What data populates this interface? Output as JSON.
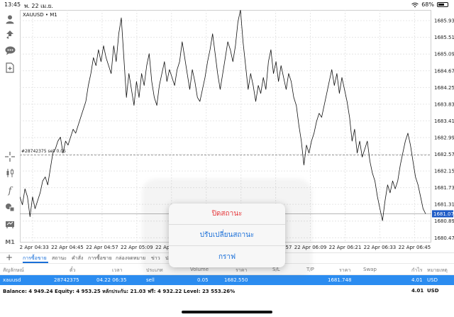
{
  "status_bar": {
    "time": "13:45",
    "date": "พ. 22 เม.ย.",
    "battery": "68%",
    "battery_level": 0.68
  },
  "sidebar": {
    "icons": [
      "user-icon",
      "trade-icon",
      "chat-icon",
      "add-document-icon",
      "crosshair-icon",
      "candles-icon",
      "function-icon",
      "objects-icon",
      "templates-icon",
      "timeframe-icon"
    ],
    "timeframe_label": "M1"
  },
  "chart": {
    "symbol_label": "XAUUSD • M1",
    "order_label": "#28742375 sell 0.05",
    "current_price_label": "1681.073",
    "colors": {
      "line": "#111111",
      "grid": "#e6e6e6",
      "order_line": "#9a9a9a",
      "price_tag": "#1e5bc6"
    }
  },
  "chart_data": {
    "type": "line",
    "x_ticks": [
      "22 Apr 04:33",
      "22 Apr 04:45",
      "22 Apr 04:57",
      "22 Apr 05:09",
      "22 Apr 05:21",
      "22 Apr 05:33",
      "22 Apr 05:45",
      "22 Apr 05:57",
      "22 Apr 06:09",
      "22 Apr 06:21",
      "22 Apr 06:33",
      "22 Apr 06:45"
    ],
    "y_ticks": [
      "1685.930",
      "1685.510",
      "1685.090",
      "1684.670",
      "1684.250",
      "1683.830",
      "1683.410",
      "1682.990",
      "1682.570",
      "1682.150",
      "1681.730",
      "1681.310",
      "1680.890",
      "1680.470"
    ],
    "ylim": [
      1680.35,
      1686.2
    ],
    "order_price": 1682.55,
    "current_price": 1681.073,
    "values": [
      1681.5,
      1681.3,
      1681.7,
      1681.5,
      1681.0,
      1681.5,
      1681.2,
      1681.4,
      1681.6,
      1681.9,
      1682.0,
      1681.8,
      1682.2,
      1682.6,
      1682.7,
      1682.9,
      1683.0,
      1682.6,
      1682.9,
      1682.8,
      1683.0,
      1683.2,
      1683.1,
      1683.3,
      1683.5,
      1683.7,
      1683.9,
      1684.3,
      1684.6,
      1685.0,
      1684.8,
      1685.2,
      1684.9,
      1685.3,
      1685.0,
      1684.8,
      1684.6,
      1685.3,
      1684.9,
      1685.6,
      1686.0,
      1685.0,
      1684.0,
      1684.6,
      1684.2,
      1683.8,
      1684.4,
      1684.0,
      1684.6,
      1684.3,
      1684.8,
      1685.1,
      1684.4,
      1684.0,
      1683.8,
      1684.3,
      1684.6,
      1684.9,
      1684.4,
      1684.7,
      1684.5,
      1684.3,
      1684.7,
      1684.9,
      1685.4,
      1685.0,
      1684.6,
      1684.2,
      1684.7,
      1684.4,
      1684.0,
      1683.9,
      1684.2,
      1684.5,
      1684.9,
      1685.2,
      1685.6,
      1685.1,
      1684.6,
      1684.2,
      1684.6,
      1685.0,
      1685.4,
      1685.2,
      1684.9,
      1685.3,
      1685.9,
      1686.2,
      1685.4,
      1684.8,
      1684.2,
      1684.6,
      1684.3,
      1683.9,
      1684.3,
      1684.1,
      1684.5,
      1684.2,
      1684.9,
      1685.2,
      1684.6,
      1684.9,
      1684.4,
      1684.8,
      1684.5,
      1684.2,
      1684.6,
      1684.4,
      1684.0,
      1683.8,
      1683.3,
      1682.9,
      1682.3,
      1682.8,
      1682.6,
      1682.9,
      1683.1,
      1683.4,
      1683.6,
      1683.5,
      1683.8,
      1684.1,
      1684.4,
      1684.7,
      1684.3,
      1684.6,
      1684.1,
      1684.5,
      1684.2,
      1683.9,
      1683.5,
      1682.9,
      1683.2,
      1682.6,
      1682.9,
      1682.5,
      1682.7,
      1682.9,
      1682.4,
      1682.1,
      1681.9,
      1681.5,
      1681.2,
      1680.9,
      1681.4,
      1681.8,
      1681.6,
      1681.9,
      1681.7,
      1681.9,
      1682.3,
      1682.6,
      1682.9,
      1683.1,
      1682.8,
      1682.4,
      1682.0,
      1681.8,
      1681.5,
      1681.2,
      1681.073
    ]
  },
  "tabs": {
    "items": [
      "การซื้อขาย",
      "สถานะ",
      "คำสั่ง",
      "การซื้อขาย",
      "กล่องจดหมาย",
      "ข่าว",
      "ปฏิ"
    ],
    "active_index": 0
  },
  "table": {
    "headers": [
      "สัญลักษณ์",
      "ตั๋ว",
      "เวลา",
      "ประเภท",
      "Volume",
      "ราคา",
      "S/L",
      "T/P",
      "ราคา",
      "Swap",
      "กำไร",
      "หมายเหตุ"
    ],
    "rows": [
      [
        "xauusd",
        "28742375",
        "04.22 06:35",
        "sell",
        "0.05",
        "1682.550",
        "",
        "",
        "1681.748",
        "",
        "4.01",
        "USD"
      ]
    ]
  },
  "summary": {
    "text": "Balance: 4 949.24 Equity: 4 953.25 หลักประกัน: 21.03 ฟรี: 4 932.22 Level: 23 553.26%",
    "profit": "4.01",
    "unit": "USD"
  },
  "popup": {
    "items": [
      {
        "label": "ปิดสถานะ",
        "kind": "danger"
      },
      {
        "label": "ปรับเปลี่ยนสถานะ",
        "kind": "normal"
      },
      {
        "label": "กราฟ",
        "kind": "normal"
      }
    ]
  }
}
